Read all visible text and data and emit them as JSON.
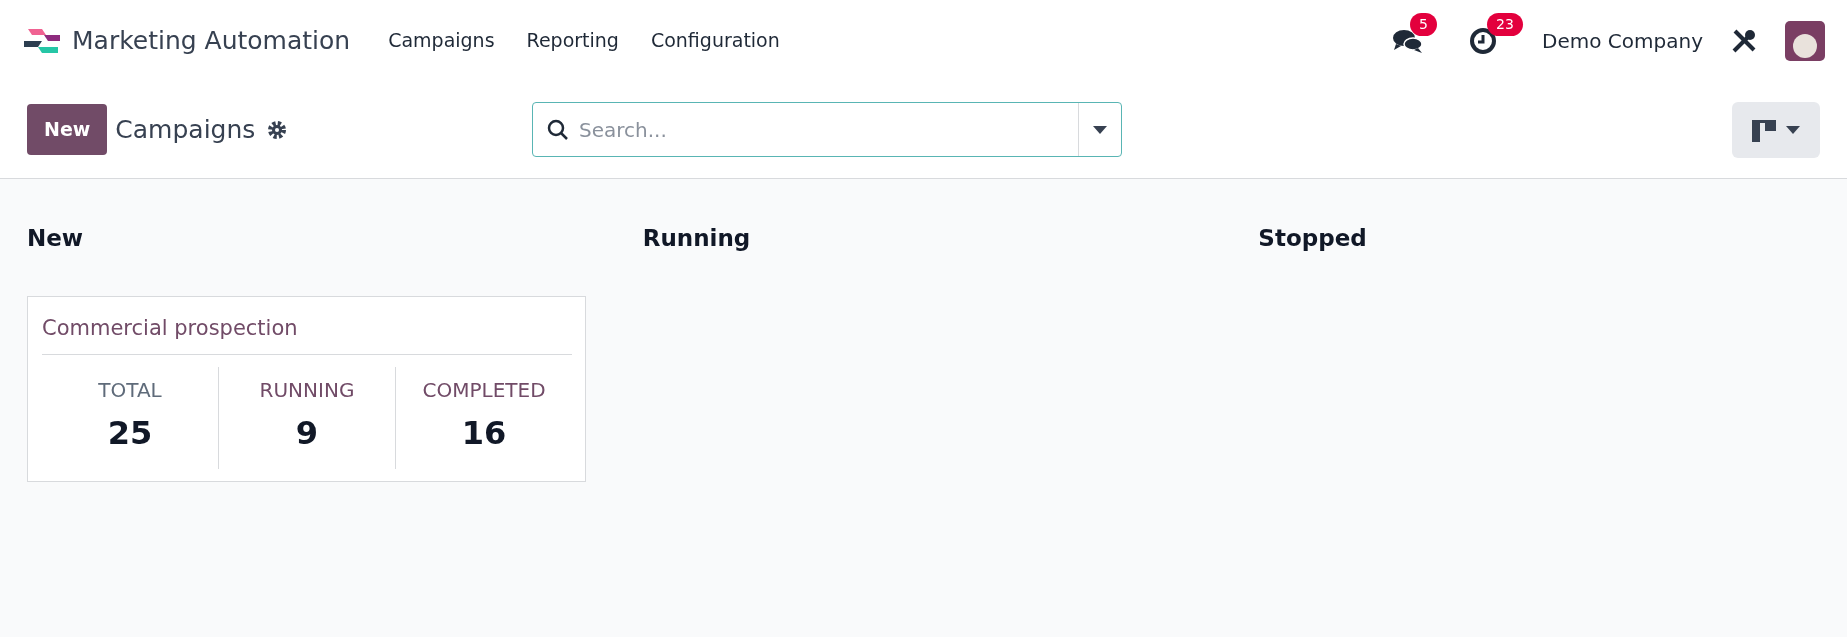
{
  "navbar": {
    "app_name": "Marketing Automation",
    "menu": [
      {
        "label": "Campaigns"
      },
      {
        "label": "Reporting"
      },
      {
        "label": "Configuration"
      }
    ],
    "messages_count": "5",
    "activities_count": "23",
    "company": "Demo Company"
  },
  "control_panel": {
    "new_button": "New",
    "title": "Campaigns",
    "search": {
      "placeholder": "Search..."
    }
  },
  "kanban": {
    "columns": [
      {
        "title": "New",
        "cards": [
          {
            "title": "Commercial prospection",
            "stats": [
              {
                "label": "TOTAL",
                "value": "25",
                "color": "#5f6b7a"
              },
              {
                "label": "RUNNING",
                "value": "9",
                "color": "#714b67"
              },
              {
                "label": "COMPLETED",
                "value": "16",
                "color": "#714b67"
              }
            ]
          }
        ]
      },
      {
        "title": "Running"
      },
      {
        "title": "Stopped"
      }
    ]
  }
}
